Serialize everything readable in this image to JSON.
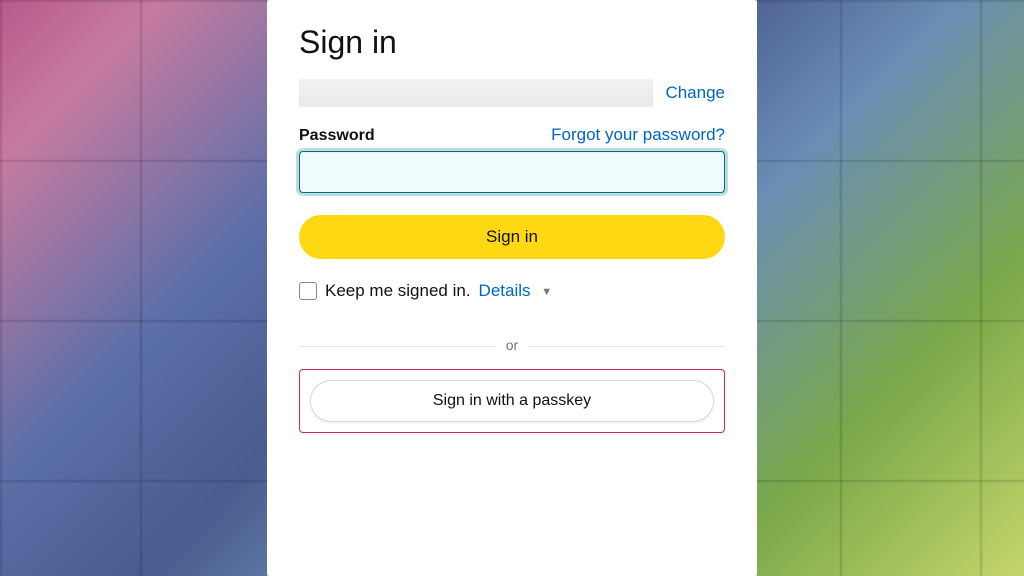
{
  "title": "Sign in",
  "email": {
    "change_label": "Change"
  },
  "password": {
    "label": "Password",
    "forgot_label": "Forgot your password?",
    "value": ""
  },
  "signin_button": "Sign in",
  "keep_signed": {
    "label": "Keep me signed in.",
    "details_label": "Details"
  },
  "divider": "or",
  "passkey_button": "Sign in with a passkey",
  "colors": {
    "link": "#0066c0",
    "primary_button": "#ffd814",
    "focus_ring": "#007185",
    "highlight_border": "#c9304f"
  }
}
